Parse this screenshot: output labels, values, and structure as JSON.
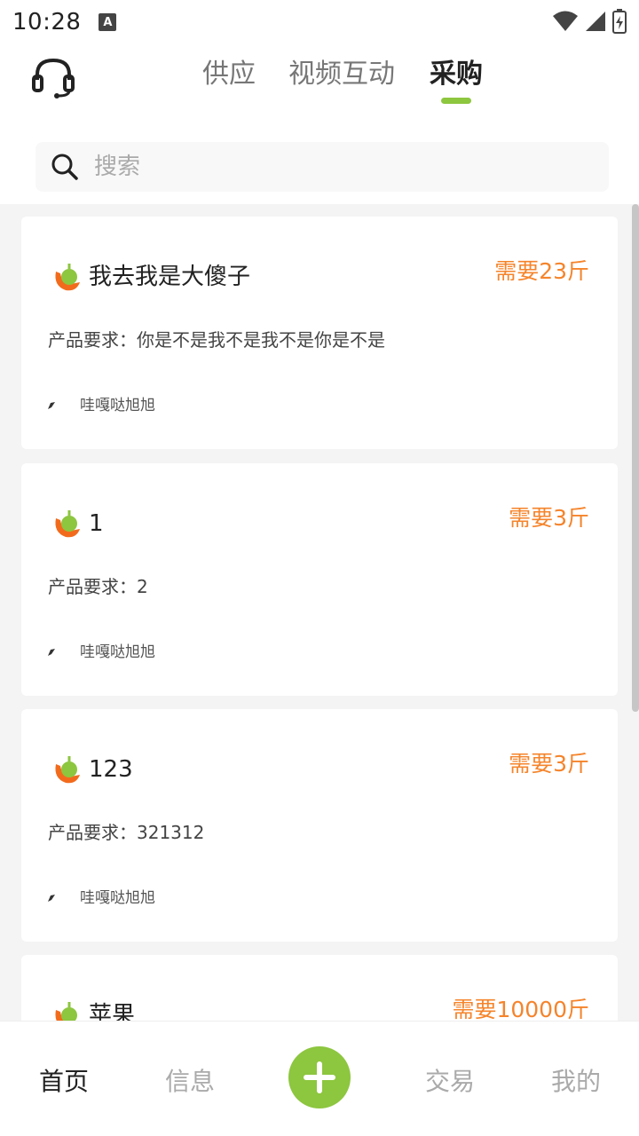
{
  "status_bar": {
    "time": "10:28",
    "notification_icon": "A",
    "icons": [
      "wifi-icon",
      "signal-icon",
      "battery-charging-icon"
    ]
  },
  "header": {
    "support_icon": "headset-icon",
    "tabs": [
      {
        "label": "供应",
        "active": false
      },
      {
        "label": "视频互动",
        "active": false
      },
      {
        "label": "采购",
        "active": true
      }
    ],
    "active_color": "#8dc63f"
  },
  "search": {
    "placeholder": "搜索",
    "value": ""
  },
  "purchases": [
    {
      "title": "我去我是大傻子",
      "need": "需要23斤",
      "requirement": "产品要求：你是不是我不是我不是你是不是",
      "user": "哇嘎哒旭旭"
    },
    {
      "title": "1",
      "need": "需要3斤",
      "requirement": "产品要求：2",
      "user": "哇嘎哒旭旭"
    },
    {
      "title": "123",
      "need": "需要3斤",
      "requirement": "产品要求：321312",
      "user": "哇嘎哒旭旭"
    },
    {
      "title": "苹果",
      "need": "需要10000斤",
      "requirement": "",
      "user": ""
    }
  ],
  "bottom_nav": {
    "items": [
      {
        "label": "首页",
        "active": true
      },
      {
        "label": "信息",
        "active": false
      },
      {
        "label": "交易",
        "active": false
      },
      {
        "label": "我的",
        "active": false
      }
    ],
    "add_icon": "plus-icon"
  },
  "colors": {
    "accent": "#8dc63f",
    "need": "#f5842b"
  }
}
